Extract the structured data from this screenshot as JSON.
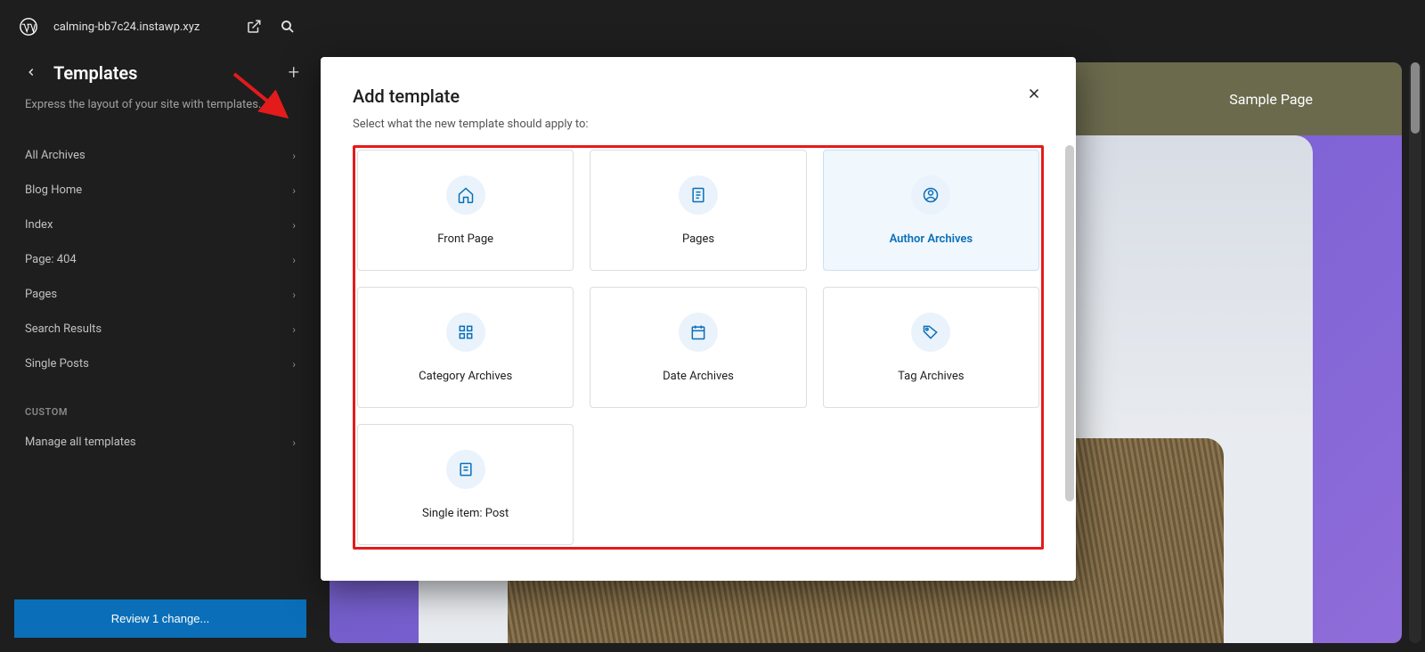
{
  "topbar": {
    "site_name": "calming-bb7c24.instawp.xyz"
  },
  "sidebar": {
    "title": "Templates",
    "description": "Express the layout of your site with templates.",
    "items": [
      {
        "label": "All Archives"
      },
      {
        "label": "Blog Home"
      },
      {
        "label": "Index"
      },
      {
        "label": "Page: 404"
      },
      {
        "label": "Pages"
      },
      {
        "label": "Search Results"
      },
      {
        "label": "Single Posts"
      }
    ],
    "custom_label": "CUSTOM",
    "manage_label": "Manage all templates",
    "review_label": "Review 1 change..."
  },
  "preview": {
    "site_name": "calming-bb7c24.instawp.xyz",
    "nav_link": "Sample Page"
  },
  "modal": {
    "title": "Add template",
    "description": "Select what the new template should apply to:",
    "templates": [
      {
        "label": "Front Page",
        "icon": "home"
      },
      {
        "label": "Pages",
        "icon": "page"
      },
      {
        "label": "Author Archives",
        "icon": "author",
        "hovered": true
      },
      {
        "label": "Category Archives",
        "icon": "category"
      },
      {
        "label": "Date Archives",
        "icon": "date"
      },
      {
        "label": "Tag Archives",
        "icon": "tag"
      },
      {
        "label": "Single item: Post",
        "icon": "single"
      }
    ]
  }
}
